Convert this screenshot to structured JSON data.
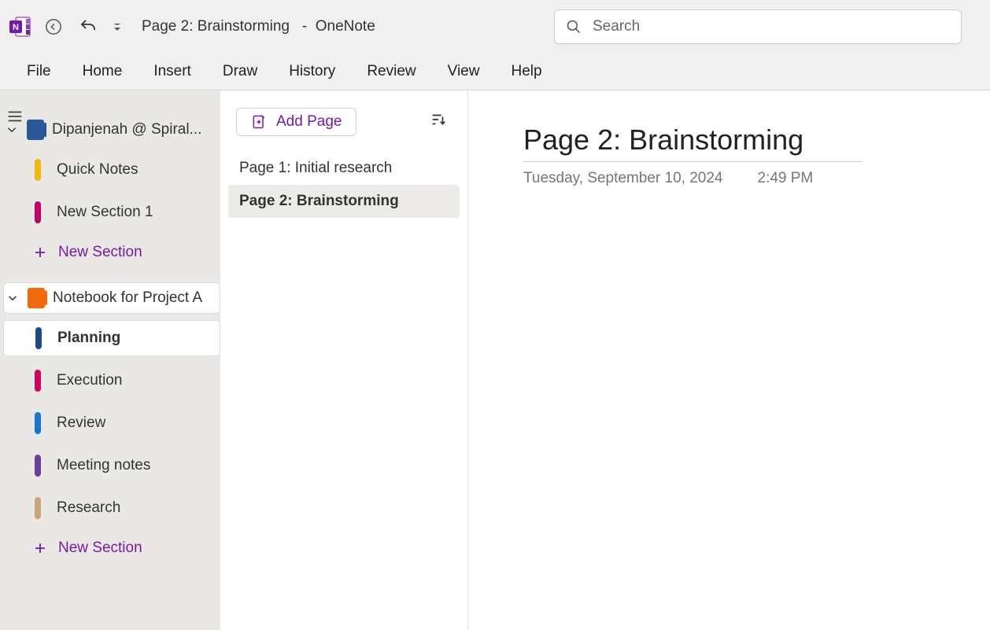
{
  "title": {
    "page": "Page 2: Brainstorming",
    "app": "OneNote",
    "combined": "Page 2: Brainstorming   -  OneNote"
  },
  "search": {
    "placeholder": "Search"
  },
  "menu": [
    "File",
    "Home",
    "Insert",
    "Draw",
    "History",
    "Review",
    "View",
    "Help"
  ],
  "notebooks": [
    {
      "name": "Dipanjenah @ Spiral...",
      "color": "#2b579a",
      "selected": false,
      "sections": [
        {
          "label": "Quick Notes",
          "color": "#f2b90f"
        },
        {
          "label": "New Section 1",
          "color": "#c3006b"
        }
      ]
    },
    {
      "name": "Notebook for Project A",
      "color": "#f2680f",
      "selected": true,
      "sections": [
        {
          "label": "Planning",
          "color": "#1a4a8a",
          "selected": true
        },
        {
          "label": "Execution",
          "color": "#d1005f"
        },
        {
          "label": "Review",
          "color": "#1976d2"
        },
        {
          "label": "Meeting notes",
          "color": "#6b3fa0"
        },
        {
          "label": "Research",
          "color": "#c7a77a"
        }
      ]
    }
  ],
  "new_section_label": "New Section",
  "pages_panel": {
    "add_label": "Add Page",
    "items": [
      {
        "label": "Page 1: Initial research",
        "selected": false
      },
      {
        "label": "Page 2: Brainstorming",
        "selected": true
      }
    ]
  },
  "canvas": {
    "title": "Page 2: Brainstorming",
    "date": "Tuesday, September 10, 2024",
    "time": "2:49 PM"
  }
}
